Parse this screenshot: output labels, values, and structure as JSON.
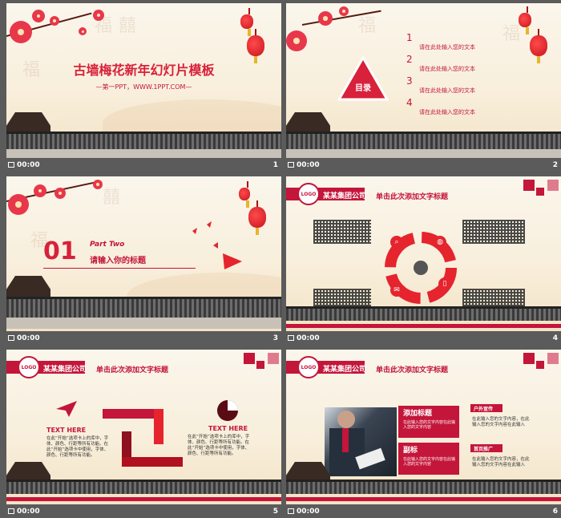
{
  "colors": {
    "accent": "#c4153a",
    "background": "#5b5b5b"
  },
  "slides": [
    {
      "number": "1",
      "time": "00:00",
      "title": "古墙梅花新年幻灯片模板",
      "subtitle": "—第一PPT，WWW.1PPT.COM—"
    },
    {
      "number": "2",
      "time": "00:00",
      "toc_label": "目录",
      "items": [
        {
          "num": "1",
          "text": "请在此处输入您的文本"
        },
        {
          "num": "2",
          "text": "请在此处输入您的文本"
        },
        {
          "num": "3",
          "text": "请在此处输入您的文本"
        },
        {
          "num": "4",
          "text": "请在此处输入您的文本"
        }
      ]
    },
    {
      "number": "3",
      "time": "00:00",
      "section_num": "01",
      "part": "Part Two",
      "section_title": "请输入你的标题"
    },
    {
      "number": "4",
      "time": "00:00",
      "logo": "LOGO",
      "company": "某某集团公司",
      "heading": "单击此次添加文字标题",
      "icons": [
        "search-icon",
        "basketball-icon",
        "phone-icon",
        "mail-icon"
      ]
    },
    {
      "number": "5",
      "time": "00:00",
      "logo": "LOGO",
      "company": "某某集团公司",
      "heading": "单击此次添加文字标题",
      "left_title": "TEXT HERE",
      "right_title": "TEXT HERE",
      "left_body": "在此“开始”选项卡上的库中，字体、颜色、行距等所有功能。在此“开始”选项卡中使用，字体、颜色、行距等所有功能。",
      "right_body": "在此“开始”选项卡上的库中，字体、颜色、行距等所有功能。在此“开始”选项卡中使用，字体、颜色、行距等所有功能。"
    },
    {
      "number": "6",
      "time": "00:00",
      "logo": "LOGO",
      "company": "某某集团公司",
      "heading": "单击此次添加文字标题",
      "box1_title": "添加标题",
      "box2_title": "副标",
      "tag1": "户外宣传",
      "tag2": "首页推广",
      "box_body": "在此输入您的文字内容在此输入您的文字内容",
      "tag_body": "在此输入您的文字内容，在此输入您的文字内容在此输入"
    }
  ]
}
